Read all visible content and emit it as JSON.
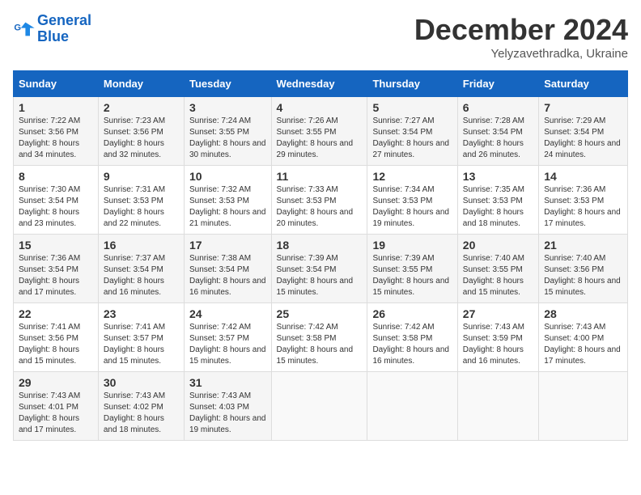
{
  "header": {
    "logo_line1": "General",
    "logo_line2": "Blue",
    "month_title": "December 2024",
    "subtitle": "Yelyzavethradka, Ukraine"
  },
  "days_of_week": [
    "Sunday",
    "Monday",
    "Tuesday",
    "Wednesday",
    "Thursday",
    "Friday",
    "Saturday"
  ],
  "weeks": [
    [
      {
        "day": "1",
        "sunrise": "7:22 AM",
        "sunset": "3:56 PM",
        "daylight": "8 hours and 34 minutes."
      },
      {
        "day": "2",
        "sunrise": "7:23 AM",
        "sunset": "3:56 PM",
        "daylight": "8 hours and 32 minutes."
      },
      {
        "day": "3",
        "sunrise": "7:24 AM",
        "sunset": "3:55 PM",
        "daylight": "8 hours and 30 minutes."
      },
      {
        "day": "4",
        "sunrise": "7:26 AM",
        "sunset": "3:55 PM",
        "daylight": "8 hours and 29 minutes."
      },
      {
        "day": "5",
        "sunrise": "7:27 AM",
        "sunset": "3:54 PM",
        "daylight": "8 hours and 27 minutes."
      },
      {
        "day": "6",
        "sunrise": "7:28 AM",
        "sunset": "3:54 PM",
        "daylight": "8 hours and 26 minutes."
      },
      {
        "day": "7",
        "sunrise": "7:29 AM",
        "sunset": "3:54 PM",
        "daylight": "8 hours and 24 minutes."
      }
    ],
    [
      {
        "day": "8",
        "sunrise": "7:30 AM",
        "sunset": "3:54 PM",
        "daylight": "8 hours and 23 minutes."
      },
      {
        "day": "9",
        "sunrise": "7:31 AM",
        "sunset": "3:53 PM",
        "daylight": "8 hours and 22 minutes."
      },
      {
        "day": "10",
        "sunrise": "7:32 AM",
        "sunset": "3:53 PM",
        "daylight": "8 hours and 21 minutes."
      },
      {
        "day": "11",
        "sunrise": "7:33 AM",
        "sunset": "3:53 PM",
        "daylight": "8 hours and 20 minutes."
      },
      {
        "day": "12",
        "sunrise": "7:34 AM",
        "sunset": "3:53 PM",
        "daylight": "8 hours and 19 minutes."
      },
      {
        "day": "13",
        "sunrise": "7:35 AM",
        "sunset": "3:53 PM",
        "daylight": "8 hours and 18 minutes."
      },
      {
        "day": "14",
        "sunrise": "7:36 AM",
        "sunset": "3:53 PM",
        "daylight": "8 hours and 17 minutes."
      }
    ],
    [
      {
        "day": "15",
        "sunrise": "7:36 AM",
        "sunset": "3:54 PM",
        "daylight": "8 hours and 17 minutes."
      },
      {
        "day": "16",
        "sunrise": "7:37 AM",
        "sunset": "3:54 PM",
        "daylight": "8 hours and 16 minutes."
      },
      {
        "day": "17",
        "sunrise": "7:38 AM",
        "sunset": "3:54 PM",
        "daylight": "8 hours and 16 minutes."
      },
      {
        "day": "18",
        "sunrise": "7:39 AM",
        "sunset": "3:54 PM",
        "daylight": "8 hours and 15 minutes."
      },
      {
        "day": "19",
        "sunrise": "7:39 AM",
        "sunset": "3:55 PM",
        "daylight": "8 hours and 15 minutes."
      },
      {
        "day": "20",
        "sunrise": "7:40 AM",
        "sunset": "3:55 PM",
        "daylight": "8 hours and 15 minutes."
      },
      {
        "day": "21",
        "sunrise": "7:40 AM",
        "sunset": "3:56 PM",
        "daylight": "8 hours and 15 minutes."
      }
    ],
    [
      {
        "day": "22",
        "sunrise": "7:41 AM",
        "sunset": "3:56 PM",
        "daylight": "8 hours and 15 minutes."
      },
      {
        "day": "23",
        "sunrise": "7:41 AM",
        "sunset": "3:57 PM",
        "daylight": "8 hours and 15 minutes."
      },
      {
        "day": "24",
        "sunrise": "7:42 AM",
        "sunset": "3:57 PM",
        "daylight": "8 hours and 15 minutes."
      },
      {
        "day": "25",
        "sunrise": "7:42 AM",
        "sunset": "3:58 PM",
        "daylight": "8 hours and 15 minutes."
      },
      {
        "day": "26",
        "sunrise": "7:42 AM",
        "sunset": "3:58 PM",
        "daylight": "8 hours and 16 minutes."
      },
      {
        "day": "27",
        "sunrise": "7:43 AM",
        "sunset": "3:59 PM",
        "daylight": "8 hours and 16 minutes."
      },
      {
        "day": "28",
        "sunrise": "7:43 AM",
        "sunset": "4:00 PM",
        "daylight": "8 hours and 17 minutes."
      }
    ],
    [
      {
        "day": "29",
        "sunrise": "7:43 AM",
        "sunset": "4:01 PM",
        "daylight": "8 hours and 17 minutes."
      },
      {
        "day": "30",
        "sunrise": "7:43 AM",
        "sunset": "4:02 PM",
        "daylight": "8 hours and 18 minutes."
      },
      {
        "day": "31",
        "sunrise": "7:43 AM",
        "sunset": "4:03 PM",
        "daylight": "8 hours and 19 minutes."
      },
      null,
      null,
      null,
      null
    ]
  ]
}
